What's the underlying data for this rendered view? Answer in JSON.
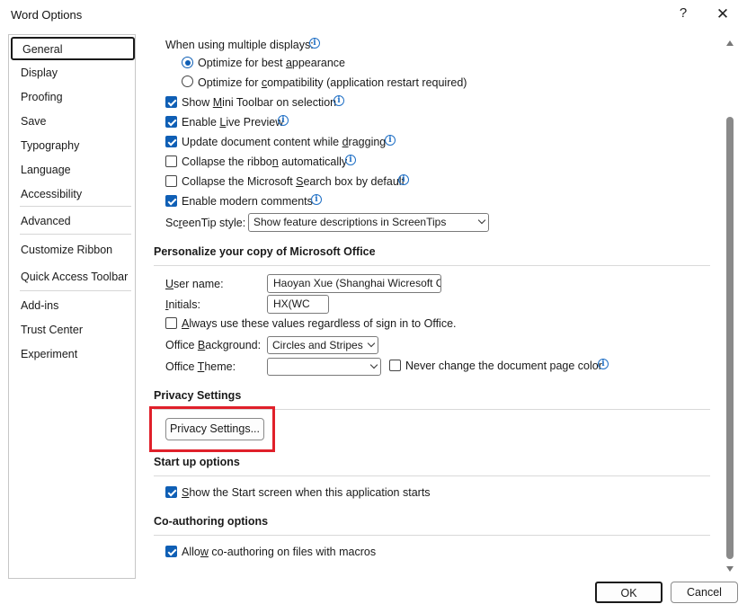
{
  "window": {
    "title": "Word Options",
    "help_glyph": "?",
    "close_glyph": "✕"
  },
  "sidebar": {
    "items": [
      {
        "label": "General"
      },
      {
        "label": "Display"
      },
      {
        "label": "Proofing"
      },
      {
        "label": "Save"
      },
      {
        "label": "Typography"
      },
      {
        "label": "Language"
      },
      {
        "label": "Accessibility"
      },
      {
        "label": "Advanced"
      },
      {
        "label": "Customize Ribbon"
      },
      {
        "label": "Quick Access Toolbar"
      },
      {
        "label": "Add-ins"
      },
      {
        "label": "Trust Center"
      },
      {
        "label": "Experiment"
      }
    ],
    "selected": "General"
  },
  "ui_options": {
    "multi_display_label": "When using multiple displays:",
    "radio_best_appearance": {
      "pre": "Optimize for best ",
      "ul": "a",
      "post": "ppearance",
      "checked": true
    },
    "radio_compatibility": {
      "pre": "Optimize for ",
      "ul": "c",
      "post": "ompatibility (application restart required)",
      "checked": false
    },
    "mini_toolbar": {
      "pre": "Show ",
      "ul": "M",
      "post": "ini Toolbar on selection",
      "checked": true
    },
    "live_preview": {
      "pre": "Enable ",
      "ul": "L",
      "post": "ive Preview",
      "checked": true
    },
    "update_dragging": {
      "pre": "Update document content while ",
      "ul": "d",
      "post": "ragging",
      "checked": true
    },
    "collapse_ribbon": {
      "pre": "Collapse the ribbo",
      "ul": "n",
      "post": " automatically",
      "checked": false
    },
    "collapse_search": {
      "pre": "Collapse the Microsoft ",
      "ul": "S",
      "post": "earch box by default",
      "checked": false
    },
    "modern_comments": {
      "pre": "Enable modern comments",
      "ul": "",
      "post": "",
      "checked": true
    },
    "screentip_label": {
      "pre": "Sc",
      "ul": "r",
      "post": "eenTip style:"
    },
    "screentip_value": "Show feature descriptions in ScreenTips"
  },
  "personalize": {
    "header": "Personalize your copy of Microsoft Office",
    "user_name_label": {
      "pre": "",
      "ul": "U",
      "post": "ser name:"
    },
    "user_name_value": "Haoyan Xue (Shanghai Wicresoft Co",
    "initials_label": {
      "pre": "",
      "ul": "I",
      "post": "nitials:"
    },
    "initials_value": "HX(WC",
    "always_use": {
      "pre": "",
      "ul": "A",
      "post": "lways use these values regardless of sign in to Office.",
      "checked": false
    },
    "background_label": {
      "pre": "Office ",
      "ul": "B",
      "post": "ackground:"
    },
    "background_value": "Circles and Stripes",
    "theme_label": {
      "pre": "Office ",
      "ul": "T",
      "post": "heme:"
    },
    "theme_value": "",
    "never_change": {
      "pre": "Never change the document page color",
      "ul": "",
      "post": "",
      "checked": false
    }
  },
  "privacy": {
    "header": "Privacy Settings",
    "button_label": "Privacy Settings..."
  },
  "startup": {
    "header": "Start up options",
    "show_start": {
      "pre": "",
      "ul": "S",
      "post": "how the Start screen when this application starts",
      "checked": true
    }
  },
  "coauthoring": {
    "header": "Co-authoring options",
    "allow": {
      "pre": "Allo",
      "ul": "w",
      "post": " co-authoring on files with macros",
      "checked": true
    }
  },
  "footer": {
    "ok_label": "OK",
    "cancel_label": "Cancel"
  },
  "colors": {
    "accent": "#0f5fb5",
    "highlight": "#e0202a"
  },
  "icons": {
    "info": "info-icon",
    "chevron": "chevron-down-icon"
  }
}
